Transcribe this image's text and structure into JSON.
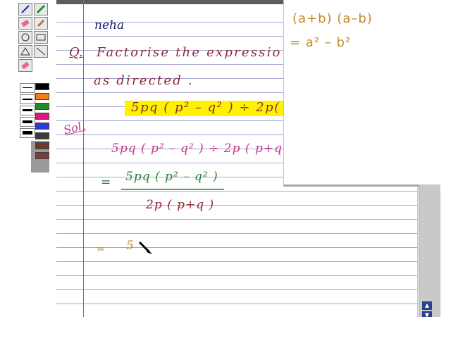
{
  "toolbar": {
    "tools": [
      {
        "name": "pen-icon"
      },
      {
        "name": "highlighter-icon"
      },
      {
        "name": "eraser-icon"
      },
      {
        "name": "brush-icon"
      },
      {
        "name": "circle-icon"
      },
      {
        "name": "rectangle-icon"
      },
      {
        "name": "triangle-icon"
      },
      {
        "name": "line-icon"
      },
      {
        "name": "clear-icon"
      }
    ],
    "pen_widths": [
      "thin",
      "medium",
      "thick",
      "thicker",
      "thickest"
    ],
    "colors": [
      "#000000",
      "#f07c1a",
      "#1e8a2a",
      "#e0157a",
      "#2a3bd6",
      "#3c3c3c",
      "#6a3a2a",
      "#7a3d3d"
    ]
  },
  "notes": {
    "name": "neha",
    "question_marker": "Q.",
    "question_line1": "Factorise the expressio",
    "question_line2": "as directed .",
    "expression_highlight": "5pq ( p² – q² ) ÷ 2p( ",
    "solution_label": "Sol.",
    "step1": "5pq ( p² – q² ) ÷ 2p ( p+q )",
    "step2_eq": "=",
    "step2_numerator": "5pq ( p² – q² )",
    "step2_denominator": "2p ( p+q )",
    "step3_eq": "=",
    "step3_partial": "5"
  },
  "formula_box": {
    "line1": "(a+b) (a–b)",
    "line2": "= a² – b²"
  },
  "scroll": {
    "up": "▲",
    "down": "▼"
  }
}
